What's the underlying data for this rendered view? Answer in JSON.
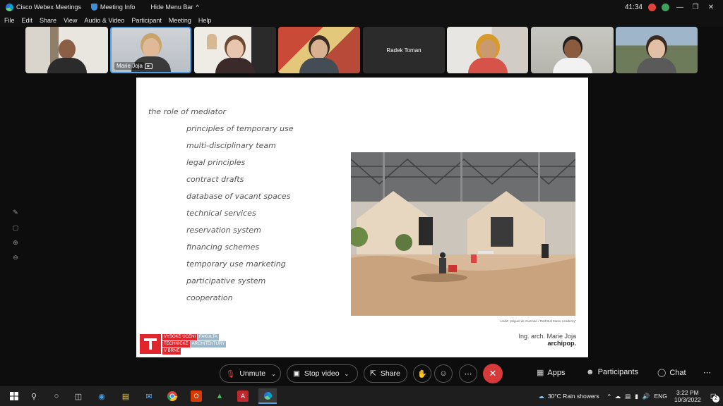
{
  "titlebar": {
    "app_name": "Cisco Webex Meetings",
    "meeting_info": "Meeting Info",
    "hide_menu": "Hide Menu Bar",
    "timer": "41:34"
  },
  "menu": [
    "File",
    "Edit",
    "Share",
    "View",
    "Audio & Video",
    "Participant",
    "Meeting",
    "Help"
  ],
  "participants": [
    {
      "name": ""
    },
    {
      "name": "Marie Joja"
    },
    {
      "name": ""
    },
    {
      "name": ""
    },
    {
      "name": "Radek Toman"
    },
    {
      "name": ""
    },
    {
      "name": ""
    },
    {
      "name": ""
    }
  ],
  "slide": {
    "heading": "the role of mediator",
    "items": [
      "principles of temporary use",
      "multi-disciplinary team",
      "legal principles",
      "contract drafts",
      "database of vacant spaces",
      "technical services",
      "reservation system",
      "financing schemes",
      "temporary use marketing",
      "participative system",
      "cooperation"
    ],
    "credit": "credit: „Miguel de Guzman / Red Bull Music Academy“",
    "presenter": "Ing. arch. Marie Joja",
    "org": "archipop.",
    "logo": {
      "line1a": "VYSOKÉ UČENÍ",
      "line1b": "FAKULTA",
      "line2a": "TECHNICKÉ",
      "line2b": "ARCHITEKTURY",
      "line3": "V BRNĚ"
    }
  },
  "controls": {
    "unmute": "Unmute",
    "stop_video": "Stop video",
    "share": "Share",
    "apps": "Apps",
    "participants": "Participants",
    "chat": "Chat"
  },
  "taskbar": {
    "weather": "30°C  Rain showers",
    "lang": "ENG",
    "time": "3:22 PM",
    "date": "10/3/2022",
    "notifications": "2"
  },
  "colors": {
    "end_call": "#d83a3a",
    "vut_red": "#e2252d",
    "vut_blue": "#9cb7c9"
  }
}
